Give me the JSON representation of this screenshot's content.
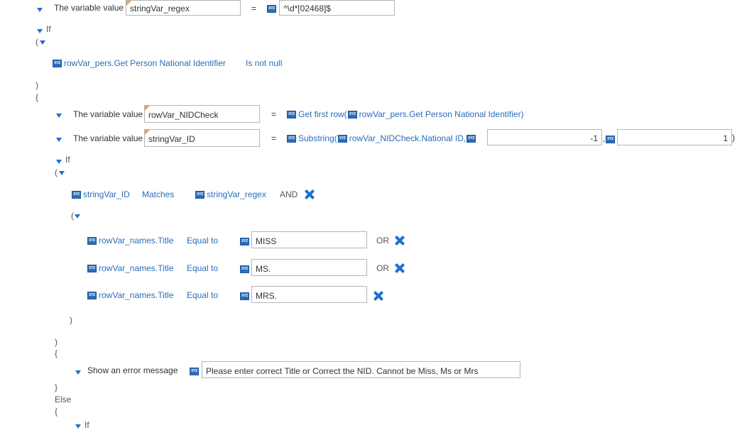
{
  "row1": {
    "label": "The variable value",
    "var": "stringVar_regex",
    "eq": "=",
    "value": "^\\d*[02468]$"
  },
  "if1": {
    "label": "If",
    "open_paren": "(",
    "cond_var": "rowVar_pers.Get Person National Identifier",
    "cond_op": "Is not null",
    "close_paren": ")",
    "open_brace": "{"
  },
  "row2": {
    "label": "The variable value",
    "var": "rowVar_NIDCheck",
    "eq": "=",
    "func": "Get first row(",
    "arg": "rowVar_pers.Get Person National Identifier)"
  },
  "row3": {
    "label": "The variable value",
    "var": "stringVar_ID",
    "eq": "=",
    "func": "Substring(",
    "arg": "rowVar_NIDCheck.National ID,",
    "num1": "-1",
    "comma": ",",
    "num2": "1",
    "close": ")"
  },
  "if2": {
    "label": "If",
    "open_paren": "(",
    "cond_var": "stringVar_ID",
    "cond_op": "Matches",
    "cond_val": "stringVar_regex",
    "cond_join": "AND",
    "inner_open": "(",
    "rows": [
      {
        "var": "rowVar_names.Title",
        "op": "Equal to",
        "value": "MISS",
        "join": "OR"
      },
      {
        "var": "rowVar_names.Title",
        "op": "Equal to",
        "value": "MS.",
        "join": "OR"
      },
      {
        "var": "rowVar_names.Title",
        "op": "Equal to",
        "value": "MRS.",
        "join": ""
      }
    ],
    "inner_close": ")",
    "close_paren": ")",
    "open_brace": "{",
    "action_label": "Show an error message",
    "action_value": "Please enter correct Title or Correct the NID. Cannot be Miss, Ms or Mrs",
    "close_brace": "}",
    "else": "Else",
    "else_brace": "{",
    "nested_if": "If"
  },
  "xyz_icon_text": "XYZ",
  "colors": {
    "accent": "#1f6fd0",
    "link": "#2a6db8",
    "flag": "#e8a05a"
  }
}
